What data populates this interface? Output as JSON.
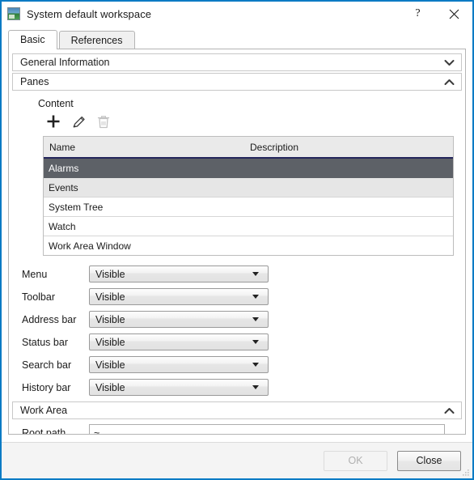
{
  "window": {
    "title": "System default workspace",
    "app_icon": "workspace-image-icon",
    "help_label": "?",
    "close_label": "×"
  },
  "tabs": [
    {
      "label": "Basic",
      "active": true
    },
    {
      "label": "References",
      "active": false
    }
  ],
  "sections": [
    {
      "key": "general_information",
      "label": "General Information",
      "expanded": false,
      "chevron": "chevron-down-icon"
    },
    {
      "key": "panes",
      "label": "Panes",
      "expanded": true,
      "chevron": "chevron-up-icon"
    },
    {
      "key": "work_area",
      "label": "Work Area",
      "expanded": true,
      "chevron": "chevron-up-icon"
    }
  ],
  "panes": {
    "content_label": "Content",
    "toolbar": [
      {
        "name": "add-icon",
        "label": "Add",
        "enabled": true
      },
      {
        "name": "edit-icon",
        "label": "Edit",
        "enabled": true
      },
      {
        "name": "delete-icon",
        "label": "Delete",
        "enabled": false
      }
    ],
    "table": {
      "columns": [
        "Name",
        "Description"
      ],
      "rows": [
        {
          "name": "Alarms",
          "description": "",
          "selected": true
        },
        {
          "name": "Events",
          "description": "",
          "selected": false
        },
        {
          "name": "System Tree",
          "description": "",
          "selected": false
        },
        {
          "name": "Watch",
          "description": "",
          "selected": false
        },
        {
          "name": "Work Area Window",
          "description": "",
          "selected": false
        }
      ]
    },
    "fields": [
      {
        "label": "Menu",
        "value": "Visible"
      },
      {
        "label": "Toolbar",
        "value": "Visible"
      },
      {
        "label": "Address bar",
        "value": "Visible"
      },
      {
        "label": "Status bar",
        "value": "Visible"
      },
      {
        "label": "Search bar",
        "value": "Visible"
      },
      {
        "label": "History bar",
        "value": "Visible"
      }
    ]
  },
  "work_area": {
    "root_path_label": "Root path",
    "root_path_value": "~"
  },
  "footer": {
    "ok_label": "OK",
    "ok_enabled": false,
    "close_label": "Close",
    "close_enabled": true
  },
  "colors": {
    "window_border": "#0a7bc4",
    "selection_bg": "#5d6167",
    "header_underline": "#24265c",
    "alt_row_bg": "#e6e6e6",
    "footer_bg": "#f4f4f4"
  }
}
